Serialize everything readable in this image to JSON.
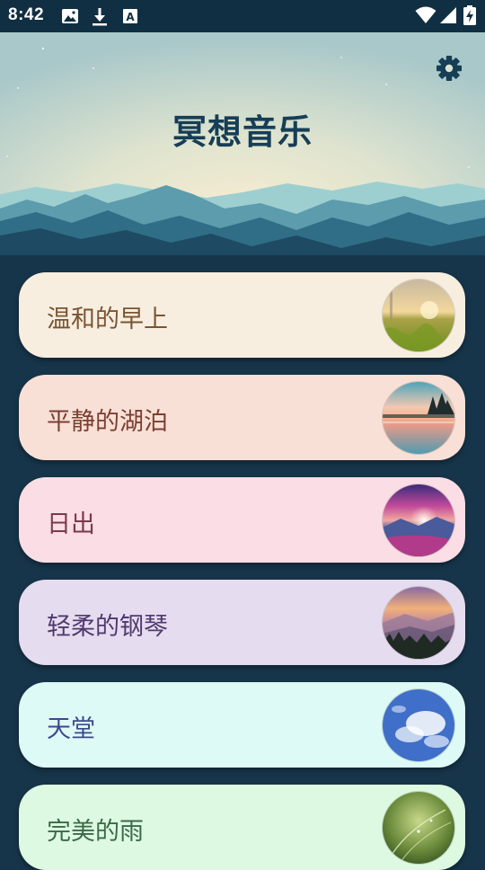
{
  "status_bar": {
    "time": "8:42",
    "left_icons": [
      "image-icon",
      "download-icon",
      "font-a-icon"
    ],
    "right_icons": [
      "wifi-icon",
      "signal-icon",
      "battery-charging-icon"
    ]
  },
  "header": {
    "title": "冥想音乐",
    "settings_icon": "gear-icon"
  },
  "tracks": [
    {
      "label": "温和的早上",
      "bg": "#f7eee0",
      "text_color": "#7a5432",
      "image": "morning-meadow-image"
    },
    {
      "label": "平静的湖泊",
      "bg": "#f9e0d6",
      "text_color": "#7a4032",
      "image": "calm-lake-image"
    },
    {
      "label": "日出",
      "bg": "#fbdde5",
      "text_color": "#7a3a4a",
      "image": "sunrise-image"
    },
    {
      "label": "轻柔的钢琴",
      "bg": "#e6dcef",
      "text_color": "#4e3a6e",
      "image": "misty-mountains-image"
    },
    {
      "label": "天堂",
      "bg": "#ddfaf7",
      "text_color": "#3c4a8a",
      "image": "blue-sky-clouds-image"
    },
    {
      "label": "完美的雨",
      "bg": "#ddf9e2",
      "text_color": "#3a6a46",
      "image": "rain-grass-image"
    }
  ]
}
